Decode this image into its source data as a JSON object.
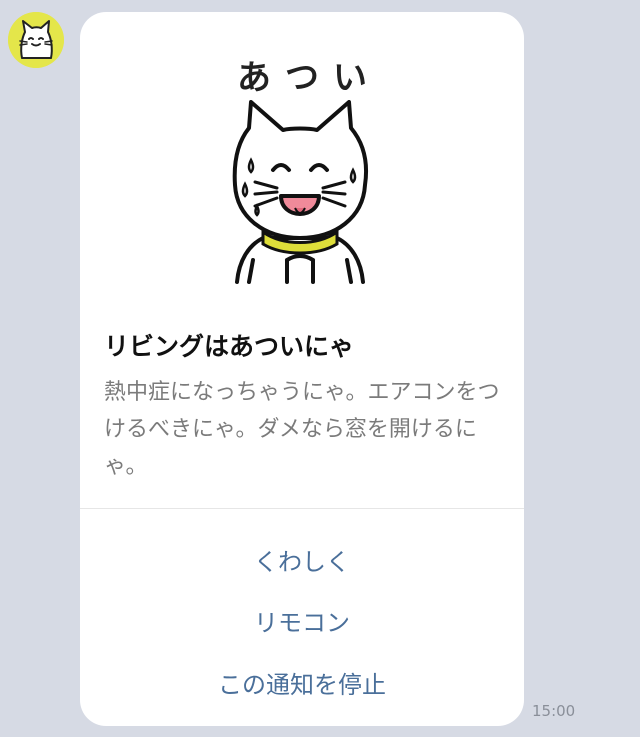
{
  "message": {
    "sticker_title": "あつい",
    "headline": "リビングはあついにゃ",
    "body": "熱中症になっちゃうにゃ。エアコンをつけるべきにゃ。ダメなら窓を開けるにゃ。",
    "actions": [
      "くわしく",
      "リモコン",
      "この通知を停止"
    ],
    "timestamp": "15:00"
  },
  "colors": {
    "background": "#d6dae4",
    "card": "#ffffff",
    "action_link": "#4a6f9a",
    "avatar_bg": "#e4e64a",
    "collar": "#dede3a",
    "tongue": "#f08a9a"
  },
  "icons": {
    "avatar": "cat-face-icon",
    "sticker": "sweating-cat-illustration"
  }
}
